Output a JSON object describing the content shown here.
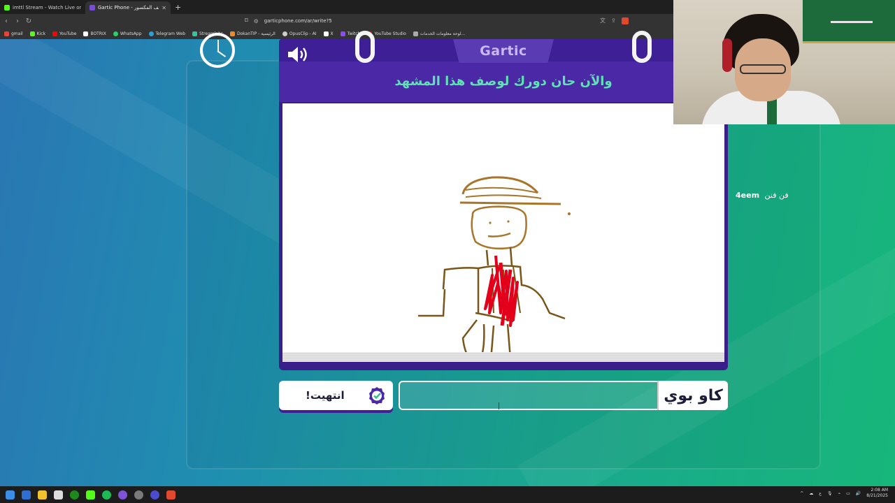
{
  "browser": {
    "tabs": [
      {
        "label": "imttl Stream - Watch Live on Kick",
        "favicon_color": "#53fc18",
        "active": false
      },
      {
        "label": "Gartic Phone - لعبة الهاتف المكسور",
        "favicon_color": "#7a4bd8",
        "active": true
      }
    ],
    "new_tab_icon": "+",
    "url": "garticphone.com/ar/write?5",
    "bookmarks": [
      {
        "label": "gmail",
        "color": "#ea4335"
      },
      {
        "label": "Kick",
        "color": "#53fc18"
      },
      {
        "label": "YouTube",
        "color": "#ff0000"
      },
      {
        "label": "BOTRIX",
        "color": "#ffffff"
      },
      {
        "label": "WhatsApp",
        "color": "#25d366"
      },
      {
        "label": "Telegram Web",
        "color": "#2aa1da"
      },
      {
        "label": "Streamlabs",
        "color": "#31c3a2"
      },
      {
        "label": "DokanTIP - الرئيسية",
        "color": "#f08a24"
      },
      {
        "label": "OpusClip - AI",
        "color": "#cccccc"
      },
      {
        "label": "X",
        "color": "#ffffff"
      },
      {
        "label": "Twitch",
        "color": "#9146ff"
      },
      {
        "label": "YouTube Studio",
        "color": "#ff0000"
      },
      {
        "label": "لوحة معلومات الخدمات...",
        "color": "#aaaaaa"
      }
    ]
  },
  "game": {
    "logo": "Gartic",
    "instruction": "والآن حان دورك لوصف هذا المشهد",
    "answer_value": "كاو بوي",
    "done_label": "انتهيت!",
    "chat": {
      "user": "4eem",
      "message": "فن فنن"
    },
    "colors": {
      "accent": "#5ee3b2",
      "card": "#4a28a6",
      "card_dark": "#3f1f96",
      "hat": "#a8752a",
      "body": "#7a5518",
      "blood": "#e3001b"
    }
  },
  "taskbar": {
    "time": "2:08 AM",
    "date": "8/21/2025"
  }
}
